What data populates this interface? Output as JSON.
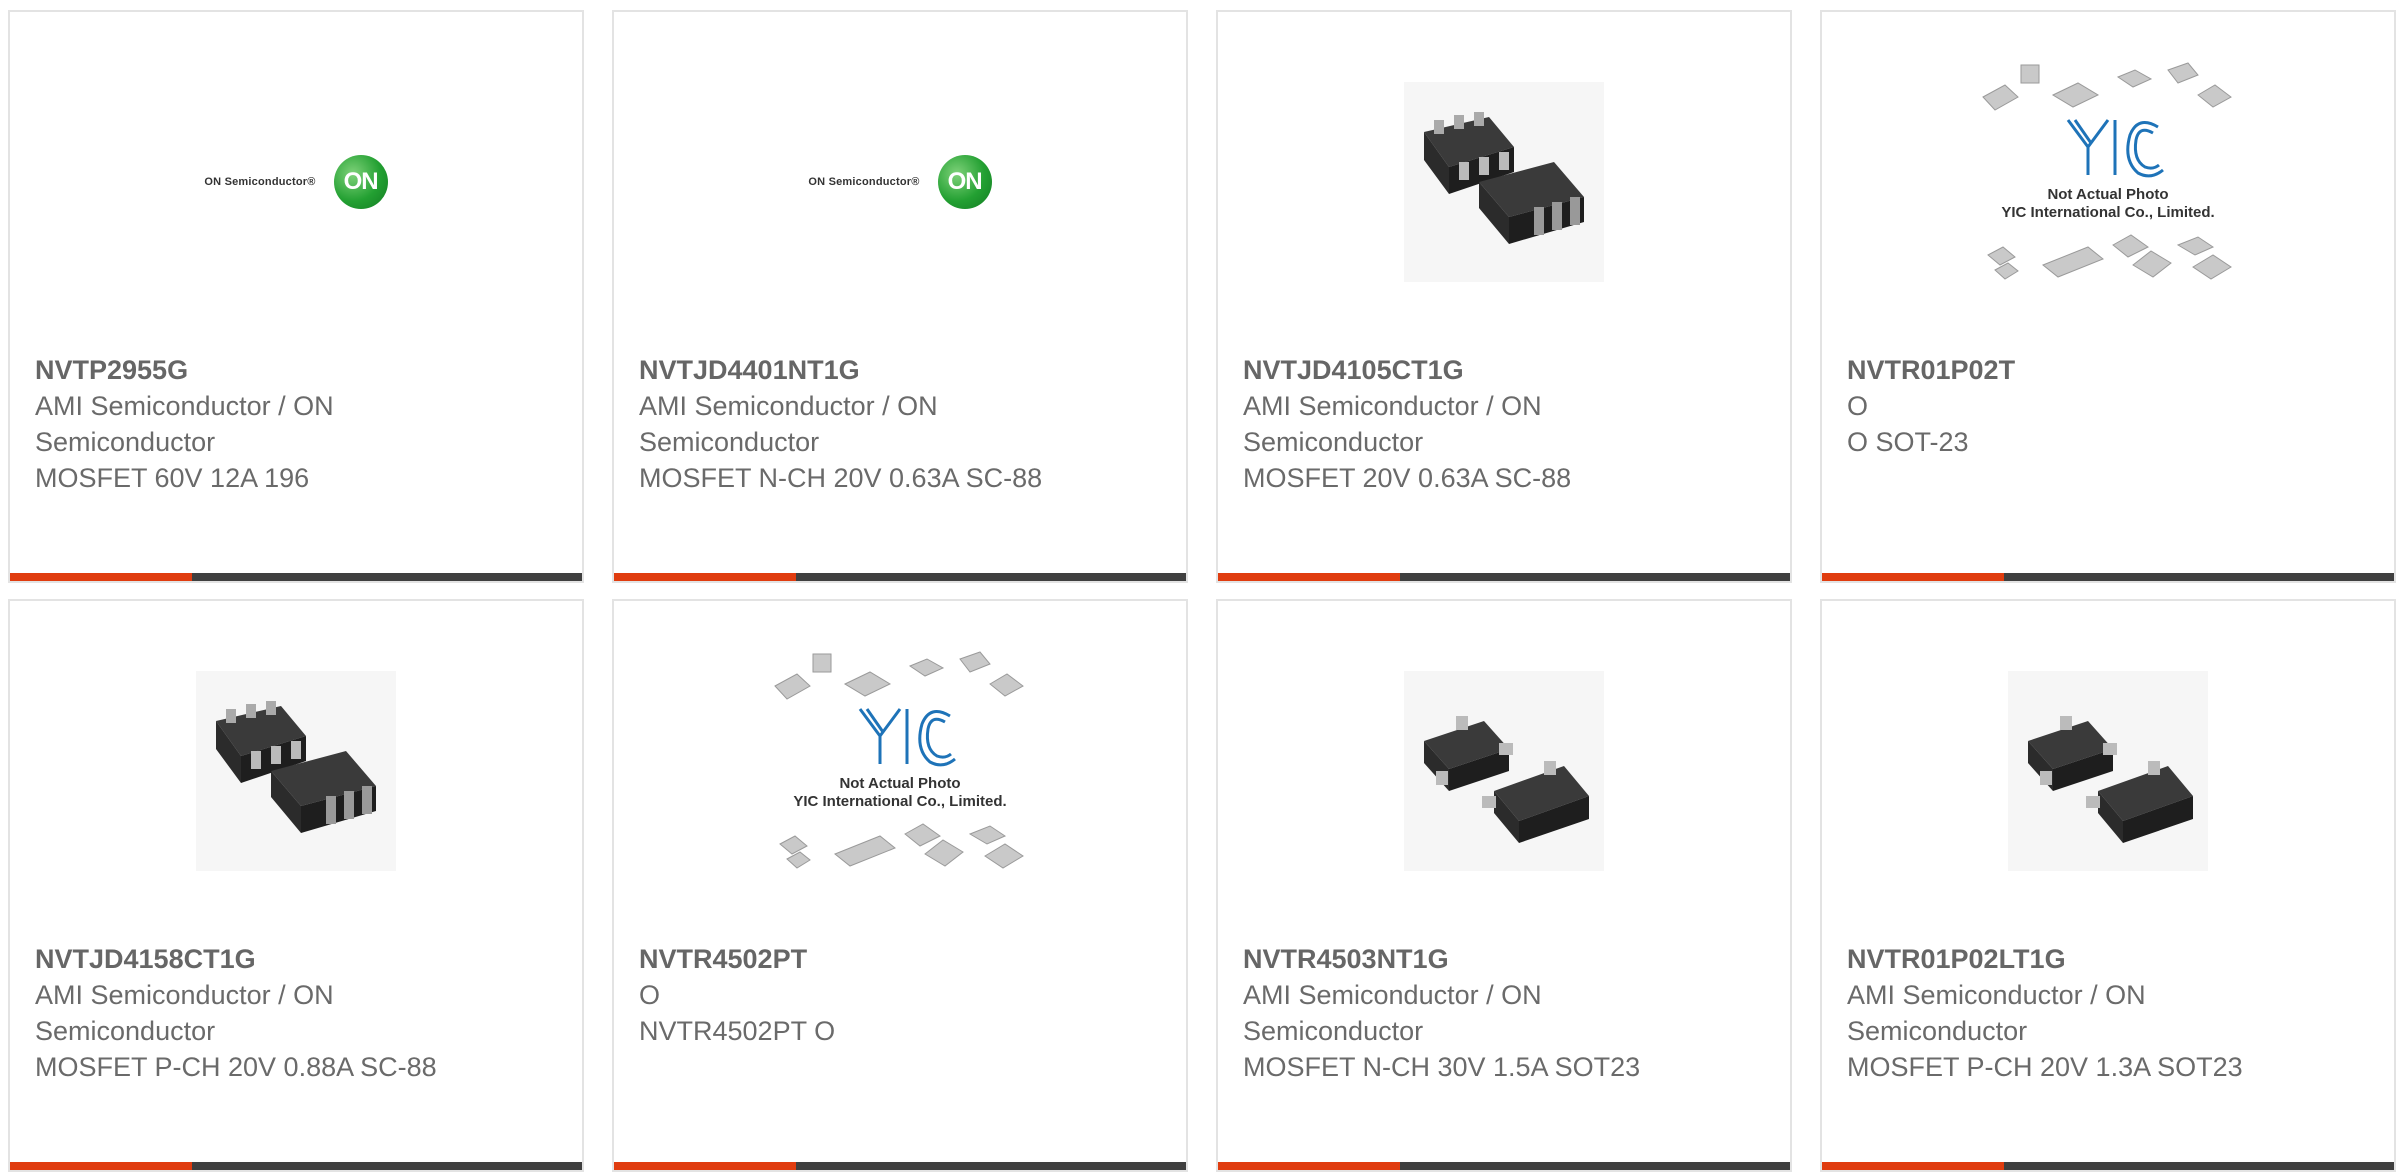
{
  "products": [
    {
      "part": "NVTP2955G",
      "mfr": "AMI Semiconductor / ON Semiconductor",
      "desc": "MOSFET 60V 12A 196",
      "image": "on-semiconductor-logo"
    },
    {
      "part": "NVTJD4401NT1G",
      "mfr": "AMI Semiconductor / ON Semiconductor",
      "desc": "MOSFET N-CH 20V 0.63A SC-88",
      "image": "on-semiconductor-logo"
    },
    {
      "part": "NVTJD4105CT1G",
      "mfr": "AMI Semiconductor / ON Semiconductor",
      "desc": "MOSFET 20V 0.63A SC-88",
      "image": "sc88-package-photo"
    },
    {
      "part": "NVTR01P02T",
      "mfr": "O",
      "desc": "O SOT-23",
      "image": "yic-not-actual-photo"
    },
    {
      "part": "NVTJD4158CT1G",
      "mfr": "AMI Semiconductor / ON Semiconductor",
      "desc": "MOSFET P-CH 20V 0.88A SC-88",
      "image": "sc88-package-photo"
    },
    {
      "part": "NVTR4502PT",
      "mfr": "O",
      "desc": "NVTR4502PT O",
      "image": "yic-not-actual-photo"
    },
    {
      "part": "NVTR4503NT1G",
      "mfr": "AMI Semiconductor / ON Semiconductor",
      "desc": "MOSFET N-CH 30V 1.5A SOT23",
      "image": "sot23-package-photo"
    },
    {
      "part": "NVTR01P02LT1G",
      "mfr": "AMI Semiconductor / ON Semiconductor",
      "desc": "MOSFET P-CH 20V 1.3A SOT23",
      "image": "sot23-package-photo"
    }
  ],
  "logo_text": {
    "on_word": "ON Semiconductor®",
    "on_disc": "ON",
    "yic_line1": "Not Actual Photo",
    "yic_line2": "YIC International Co., Limited."
  },
  "colors": {
    "accent": "#e03c0f",
    "bar": "#3f3f3f",
    "border": "#e3e3e3",
    "text": "#6a6a6a"
  }
}
